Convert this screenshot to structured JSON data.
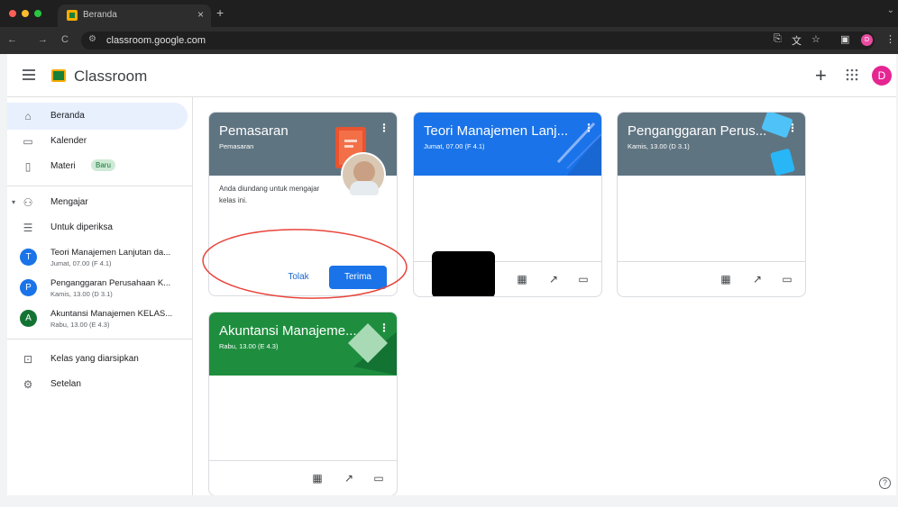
{
  "browser": {
    "tab_title": "Beranda",
    "url": "classroom.google.com",
    "profile_initial": "D"
  },
  "app": {
    "brand": "Classroom",
    "avatar_initial": "D"
  },
  "sidebar": {
    "items": [
      {
        "label": "Beranda",
        "icon": "home-icon"
      },
      {
        "label": "Kalender",
        "icon": "calendar-icon"
      },
      {
        "label": "Materi",
        "icon": "materials-icon",
        "badge": "Baru"
      },
      {
        "label": "Mengajar",
        "icon": "teaching-icon"
      },
      {
        "label": "Untuk diperiksa",
        "icon": "review-icon"
      }
    ],
    "classes": [
      {
        "initial": "T",
        "name": "Teori Manajemen Lanjutan da...",
        "schedule": "Jumat, 07.00 (F 4.1)",
        "color": "#1a73e8"
      },
      {
        "initial": "P",
        "name": "Penganggaran Perusahaan K...",
        "schedule": "Kamis, 13.00 (D 3.1)",
        "color": "#1a73e8"
      },
      {
        "initial": "A",
        "name": "Akuntansi Manajemen KELAS...",
        "schedule": "Rabu, 13.00 (E 4.3)",
        "color": "#137333"
      }
    ],
    "archived_label": "Kelas yang diarsipkan",
    "settings_label": "Setelan"
  },
  "cards": [
    {
      "title": "Pemasaran",
      "subtitle": "Pemasaran",
      "color": "#5f7481",
      "invite_text": "Anda diundang untuk mengajar kelas ini.",
      "decline_label": "Tolak",
      "accept_label": "Terima"
    },
    {
      "title": "Teori Manajemen Lanj...",
      "subtitle": "Jumat, 07.00 (F 4.1)",
      "color": "#1a73e8"
    },
    {
      "title": "Penganggaran Perus...",
      "subtitle": "Kamis, 13.00 (D 3.1)",
      "color": "#5f7481"
    },
    {
      "title": "Akuntansi Manajeme...",
      "subtitle": "Rabu, 13.00 (E 4.3)",
      "color": "#1e8e3e"
    }
  ],
  "help_label": "?"
}
